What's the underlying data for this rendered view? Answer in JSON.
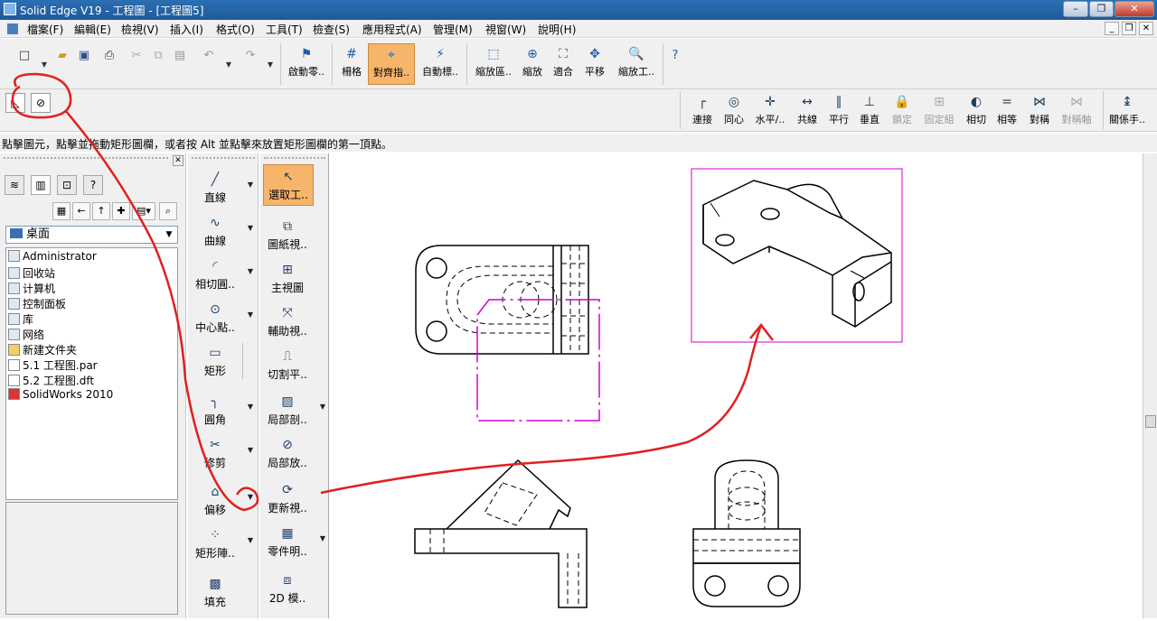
{
  "window": {
    "title": "Solid Edge V19 - 工程圖 - [工程圖5]"
  },
  "menu": [
    "檔案(F)",
    "編輯(E)",
    "檢視(V)",
    "插入(I)",
    "格式(O)",
    "工具(T)",
    "檢查(S)",
    "應用程式(A)",
    "管理(M)",
    "視窗(W)",
    "說明(H)"
  ],
  "toolbar": {
    "buttons": [
      "啟動零..",
      "柵格",
      "對齊指..",
      "自動標..",
      "縮放區..",
      "縮放",
      "適合",
      "平移",
      "縮放工.."
    ]
  },
  "relations": {
    "buttons": [
      "連接",
      "同心",
      "水平/..",
      "共線",
      "平行",
      "垂直",
      "鎖定",
      "固定組",
      "相切",
      "相等",
      "對稱",
      "對稱軸",
      "關係手.."
    ]
  },
  "status": {
    "prompt": "點擊圖元，點擊並拖動矩形圖欄，或者按 Alt 並點擊來放置矩形圖欄的第一頂點。"
  },
  "explorer": {
    "location": "桌面",
    "items": [
      "Administrator",
      "回收站",
      "计算机",
      "控制面板",
      "库",
      "网络",
      "新建文件夹",
      "5.1 工程图.par",
      "5.2 工程图.dft",
      "SolidWorks 2010"
    ]
  },
  "draw_tools": [
    "直線",
    "曲線",
    "相切圓..",
    "中心點..",
    "矩形",
    "圓角",
    "修剪",
    "偏移",
    "矩形陣..",
    "填充"
  ],
  "view_tools": [
    "選取工..",
    "圖紙視..",
    "主視圖",
    "輔助視..",
    "切割平..",
    "局部剖..",
    "局部放..",
    "更新視..",
    "零件明..",
    "2D 模.."
  ],
  "colors": {
    "accent_active": "#f7b56b",
    "annotation_red": "#e02020",
    "selection_magenta": "#d000d0"
  }
}
